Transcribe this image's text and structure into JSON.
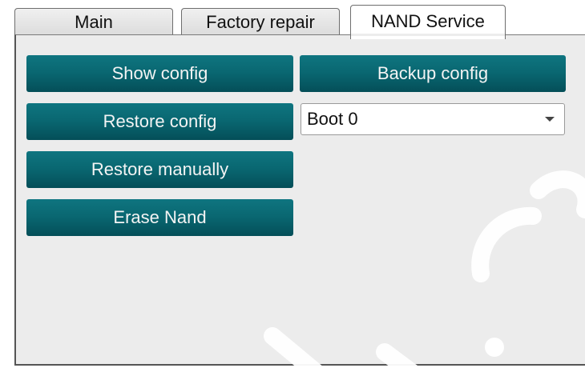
{
  "tabs": {
    "main": "Main",
    "factory_repair": "Factory repair",
    "nand_service": "NAND Service",
    "active": "NAND Service"
  },
  "buttons": {
    "show_config": "Show config",
    "backup_config": "Backup config",
    "restore_config": "Restore config",
    "restore_manually": "Restore manually",
    "erase_nand": "Erase Nand"
  },
  "boot_select": {
    "value": "Boot 0",
    "arrow_icon": "chevron-down-icon"
  },
  "colors": {
    "button_teal": "#096670",
    "panel_bg": "#ececec",
    "active_tab_bg": "#ffffff"
  }
}
